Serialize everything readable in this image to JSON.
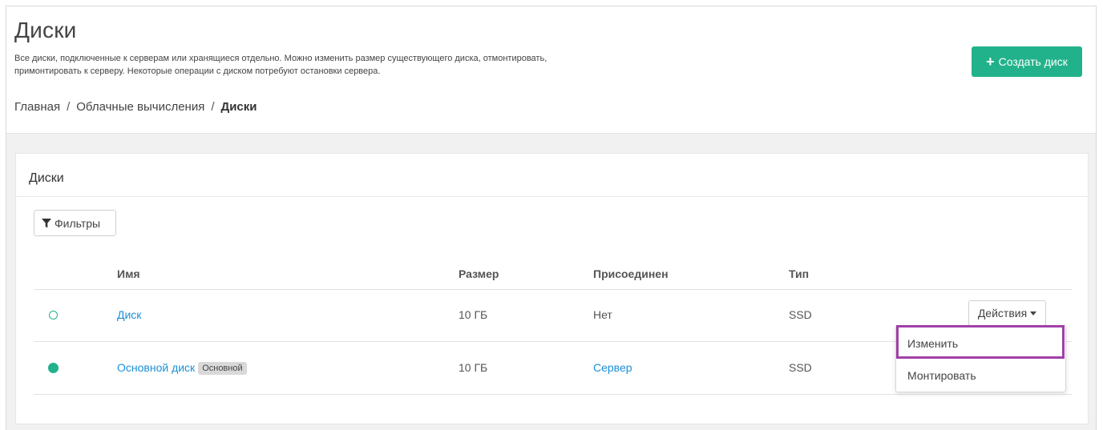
{
  "page": {
    "title": "Диски",
    "description_line1": "Все диски, подключенные к серверам или хранящиеся отдельно. Можно изменить размер существующего диска, отмонтировать,",
    "description_line2": "примонтировать к серверу. Некоторые операции с диском потребуют остановки сервера.",
    "create_button_label": "Создать диск",
    "create_button_icon": "plus-icon"
  },
  "breadcrumb": {
    "items": [
      "Главная",
      "Облачные вычисления",
      "Диски"
    ],
    "separator": "/"
  },
  "card": {
    "title": "Диски",
    "filter_label": "Фильтры",
    "filter_icon": "filter-icon"
  },
  "table": {
    "headers": [
      "Имя",
      "Размер",
      "Присоединен",
      "Тип"
    ],
    "rows": [
      {
        "status": "inactive",
        "name": "Диск",
        "badge": "",
        "size": "10 ГБ",
        "attached": "Нет",
        "type": "SSD",
        "actions_label": "Действия"
      },
      {
        "status": "active",
        "name": "Основной диск",
        "badge": "Основной",
        "size": "10 ГБ",
        "attached": "Сервер",
        "type": "SSD"
      }
    ]
  },
  "dropdown": {
    "items": [
      "Изменить",
      "Монтировать"
    ],
    "highlighted": "Изменить"
  },
  "colors": {
    "accent": "#22b28b",
    "link": "#1a8fd8",
    "highlight": "#a040a8"
  }
}
